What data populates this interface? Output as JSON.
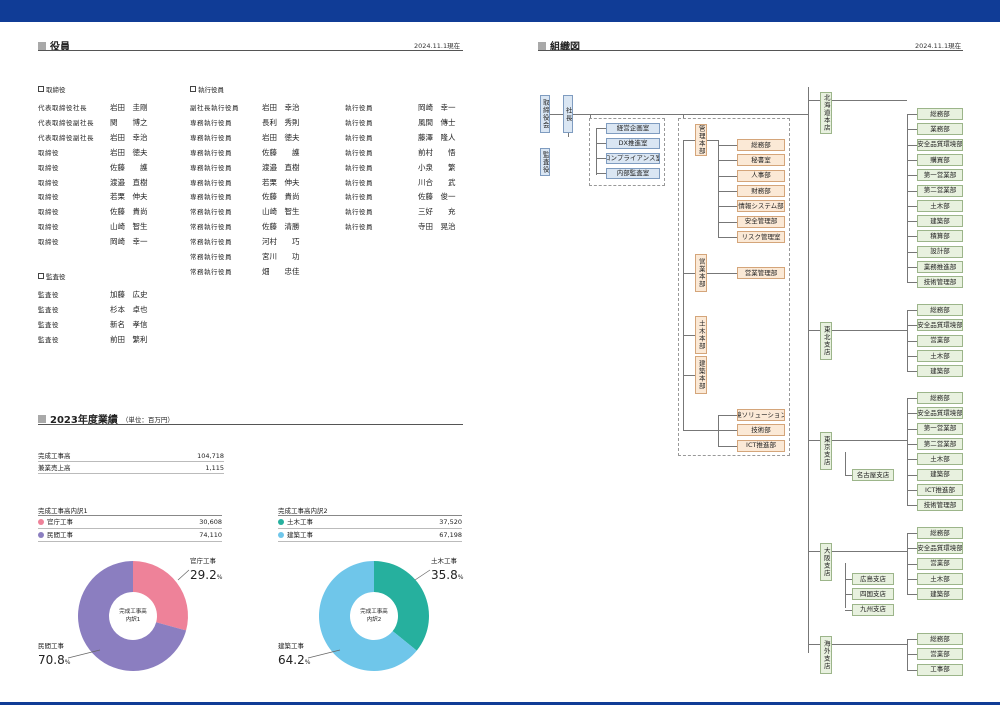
{
  "colors": {
    "topbar": "#103c96",
    "gov": "#ee8299",
    "private": "#8b7ec0",
    "civil": "#26b09e",
    "build": "#6fc6ea"
  },
  "left": {
    "title": "役員",
    "date": "2024.11.1現在",
    "directors_label": "取締役",
    "directors": [
      {
        "pos": "代表取締役社長",
        "name": "岩田　圭剛"
      },
      {
        "pos": "代表取締役副社長",
        "name": "関　　博之"
      },
      {
        "pos": "代表取締役副社長",
        "name": "岩田　幸治"
      },
      {
        "pos": "取締役",
        "name": "岩田　徳夫"
      },
      {
        "pos": "取締役",
        "name": "佐藤　　護"
      },
      {
        "pos": "取締役",
        "name": "渡邉　直樹"
      },
      {
        "pos": "取締役",
        "name": "若栗　伸夫"
      },
      {
        "pos": "取締役",
        "name": "佐藤　貴尚"
      },
      {
        "pos": "取締役",
        "name": "山崎　智生"
      },
      {
        "pos": "取締役",
        "name": "岡崎　幸一"
      }
    ],
    "auditors_label": "監査役",
    "auditors": [
      {
        "pos": "監査役",
        "name": "加藤　広史"
      },
      {
        "pos": "監査役",
        "name": "杉本　卓也"
      },
      {
        "pos": "監査役",
        "name": "新名　孝信"
      },
      {
        "pos": "監査役",
        "name": "前田　繁利"
      }
    ],
    "officers_label": "執行役員",
    "officers_a": [
      {
        "pos": "副社長執行役員",
        "name": "岩田　幸治"
      },
      {
        "pos": "専務執行役員",
        "name": "長利　秀則"
      },
      {
        "pos": "専務執行役員",
        "name": "岩田　徳夫"
      },
      {
        "pos": "専務執行役員",
        "name": "佐藤　　護"
      },
      {
        "pos": "専務執行役員",
        "name": "渡邉　直樹"
      },
      {
        "pos": "専務執行役員",
        "name": "若栗　伸夫"
      },
      {
        "pos": "専務執行役員",
        "name": "佐藤　貴尚"
      },
      {
        "pos": "常務執行役員",
        "name": "山崎　智生"
      },
      {
        "pos": "常務執行役員",
        "name": "佐藤　清勝"
      },
      {
        "pos": "常務執行役員",
        "name": "河村　　巧"
      },
      {
        "pos": "常務執行役員",
        "name": "宮川　　功"
      },
      {
        "pos": "常務執行役員",
        "name": "畑　　忠佳"
      }
    ],
    "officers_b": [
      {
        "pos": "執行役員",
        "name": "岡崎　幸一"
      },
      {
        "pos": "執行役員",
        "name": "風間　傳士"
      },
      {
        "pos": "執行役員",
        "name": "藤澤　隆人"
      },
      {
        "pos": "執行役員",
        "name": "前村　　悟"
      },
      {
        "pos": "執行役員",
        "name": "小泉　　繁"
      },
      {
        "pos": "執行役員",
        "name": "川合　　武"
      },
      {
        "pos": "執行役員",
        "name": "佐藤　俊一"
      },
      {
        "pos": "執行役員",
        "name": "三好　　充"
      },
      {
        "pos": "執行役員",
        "name": "寺田　晃治"
      }
    ],
    "perf_title": "2023年度業績",
    "perf_unit": "（単位：百万円）",
    "perf_rows": [
      {
        "label": "完成工事高",
        "value": "104,718"
      },
      {
        "label": "兼業売上高",
        "value": "1,115"
      }
    ],
    "pie1": {
      "title": "完成工事高内訳1",
      "rows": [
        {
          "label": "官庁工事",
          "value": "30,608"
        },
        {
          "label": "民間工事",
          "value": "74,110"
        }
      ],
      "center": [
        "完成工事高",
        "内訳1"
      ],
      "a_label": "官庁工事",
      "a_num": "29.2",
      "a_unit": "%",
      "b_label": "民間工事",
      "b_num": "70.8",
      "b_unit": "%"
    },
    "pie2": {
      "title": "完成工事高内訳2",
      "rows": [
        {
          "label": "土木工事",
          "value": "37,520"
        },
        {
          "label": "建築工事",
          "value": "67,198"
        }
      ],
      "center": [
        "完成工事高",
        "内訳2"
      ],
      "a_label": "土木工事",
      "a_num": "35.8",
      "a_unit": "%",
      "b_label": "建築工事",
      "b_num": "64.2",
      "b_unit": "%"
    }
  },
  "chart_data": [
    {
      "type": "pie",
      "title": "完成工事高内訳1",
      "categories": [
        "官庁工事",
        "民間工事"
      ],
      "values": [
        30608,
        74110
      ],
      "percent": [
        29.2,
        70.8
      ]
    },
    {
      "type": "pie",
      "title": "完成工事高内訳2",
      "categories": [
        "土木工事",
        "建築工事"
      ],
      "values": [
        37520,
        67198
      ],
      "percent": [
        35.8,
        64.2
      ]
    }
  ],
  "right": {
    "title": "組織図",
    "date": "2024.11.1現在",
    "board": "取締役会",
    "auditor": "監査役",
    "president": "社長",
    "staff": [
      "経営企画室",
      "DX推進室",
      "コンプライアンス室",
      "内部監査室"
    ],
    "hq_mgmt": "管理本部",
    "mgmt_depts": [
      "総務部",
      "秘書室",
      "人事部",
      "財務部",
      "情報システム部",
      "安全管理部",
      "リスク管理室"
    ],
    "hq_sales": "営業本部",
    "sales_depts": [
      "営業管理部"
    ],
    "hq_civil": "土木本部",
    "hq_build": "建築本部",
    "eng_depts": [
      "環境ソリューション部",
      "技術部",
      "ICT推進部"
    ],
    "hokkaido": "北海道本店",
    "hokkaido_depts": [
      "総務部",
      "業務部",
      "安全品質環境部",
      "購買部",
      "第一営業部",
      "第二営業部",
      "土木部",
      "建築部",
      "積算部",
      "設計部",
      "業務推進部",
      "技術管理部"
    ],
    "tohoku": "東北支店",
    "tohoku_depts": [
      "総務部",
      "安全品質環境部",
      "営業部",
      "土木部",
      "建築部"
    ],
    "tokyo": "東京支店",
    "tokyo_depts": [
      "総務部",
      "安全品質環境部",
      "第一営業部",
      "第二営業部",
      "土木部",
      "建築部",
      "ICT推進部",
      "技術管理部"
    ],
    "nagoya": "名古屋支店",
    "osaka": "大阪支店",
    "osaka_depts": [
      "総務部",
      "安全品質環境部",
      "営業部",
      "土木部",
      "建築部"
    ],
    "osaka_subs": [
      "広島支店",
      "四国支店",
      "九州支店"
    ],
    "overseas": "海外支店",
    "overseas_depts": [
      "総務部",
      "営業部",
      "工事部"
    ]
  }
}
